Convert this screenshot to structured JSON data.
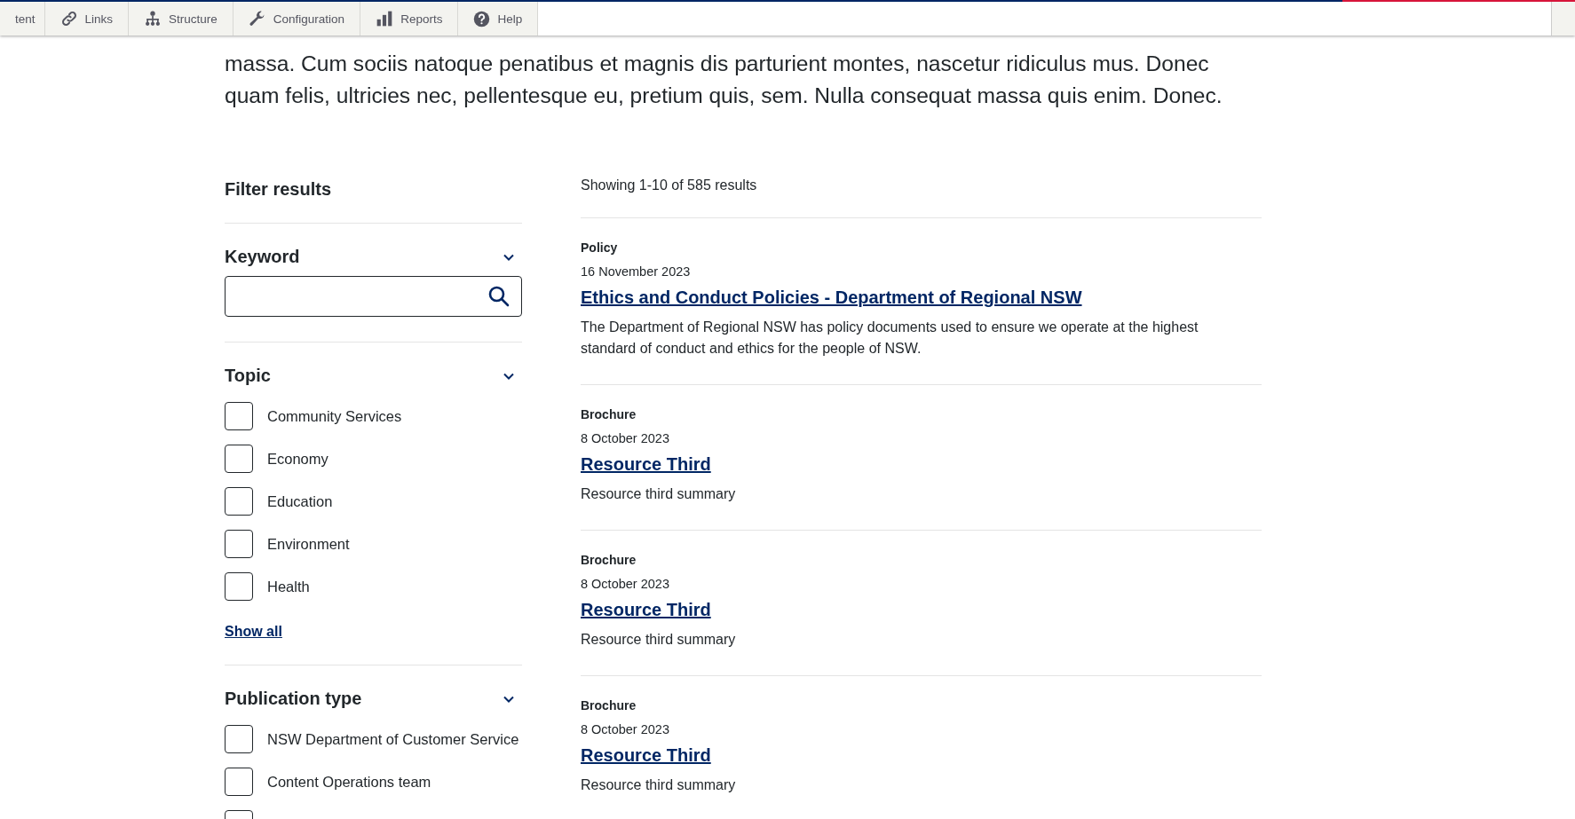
{
  "toolbar": {
    "items": [
      {
        "label": "tent"
      },
      {
        "label": "Links"
      },
      {
        "label": "Structure"
      },
      {
        "label": "Configuration"
      },
      {
        "label": "Reports"
      },
      {
        "label": "Help"
      }
    ]
  },
  "intro": {
    "lines": [
      "massa. Cum sociis natoque penatibus et magnis dis parturient montes, nascetur ridiculus mus. Donec",
      "quam felis, ultricies nec, pellentesque eu, pretium quis, sem. Nulla consequat massa quis enim. Donec."
    ]
  },
  "filters": {
    "title": "Filter results",
    "sections": [
      {
        "kind": "search",
        "title": "Keyword",
        "expanded": true
      },
      {
        "kind": "checklist",
        "title": "Topic",
        "expanded": true,
        "options": [
          {
            "label": "Community Services",
            "checked": false
          },
          {
            "label": "Economy",
            "checked": false
          },
          {
            "label": "Education",
            "checked": false
          },
          {
            "label": "Environment",
            "checked": false
          },
          {
            "label": "Health",
            "checked": false
          }
        ],
        "show_all": "Show all"
      },
      {
        "kind": "checklist",
        "title": "Publication type",
        "expanded": true,
        "options": [
          {
            "label": "NSW Department of Customer Service",
            "checked": false
          },
          {
            "label": "Content Operations team",
            "checked": false
          },
          {
            "checked": false
          }
        ]
      }
    ]
  },
  "results": {
    "summary": "Showing 1-10 of 585 results",
    "items": [
      {
        "type": "Policy",
        "date": "16 November 2023",
        "title": "Ethics and Conduct Policies - Department of Regional NSW",
        "summary": "The Department of Regional NSW has policy documents used to ensure we operate at the highest standard of conduct and ethics for the people of NSW."
      },
      {
        "type": "Brochure",
        "date": "8 October 2023",
        "title": "Resource Third",
        "summary": "Resource third summary"
      },
      {
        "type": "Brochure",
        "date": "8 October 2023",
        "title": "Resource Third",
        "summary": "Resource third summary"
      },
      {
        "type": "Brochure",
        "date": "8 October 2023",
        "title": "Resource Third",
        "summary": "Resource third summary"
      }
    ]
  }
}
